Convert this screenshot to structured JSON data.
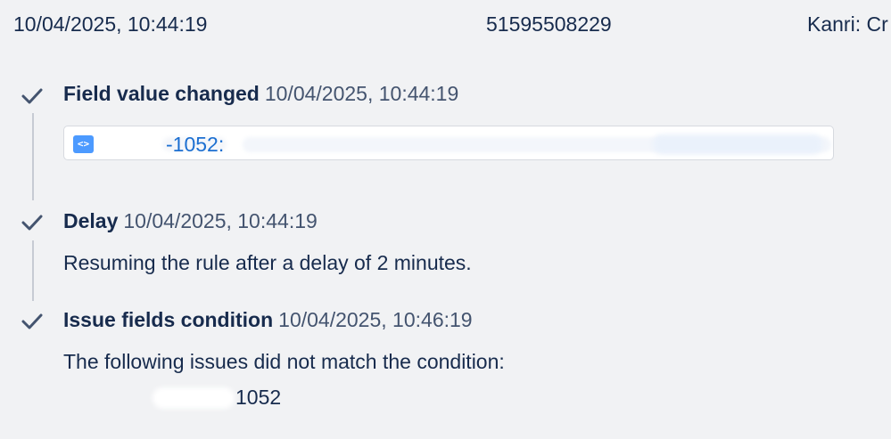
{
  "header": {
    "date": "10/04/2025, 10:44:19",
    "id": "51595508229",
    "actor": "Kanri: Cr"
  },
  "steps": [
    {
      "name": "Field value changed",
      "time": "10/04/2025, 10:44:19",
      "status": "done",
      "issue": {
        "icon": "code-icon",
        "key": "-1052:"
      }
    },
    {
      "name": "Delay",
      "time": "10/04/2025, 10:44:19",
      "status": "done",
      "message": "Resuming the rule after a delay of 2 minutes."
    },
    {
      "name": "Issue fields condition",
      "time": "10/04/2025, 10:46:19",
      "status": "done",
      "message": "The following issues did not match the condition:",
      "issue_key": "1052"
    }
  ],
  "colors": {
    "check": "#44546f",
    "link": "#1c6fd1",
    "icon_bg": "#4c9aff",
    "background": "#f1f2f4"
  }
}
